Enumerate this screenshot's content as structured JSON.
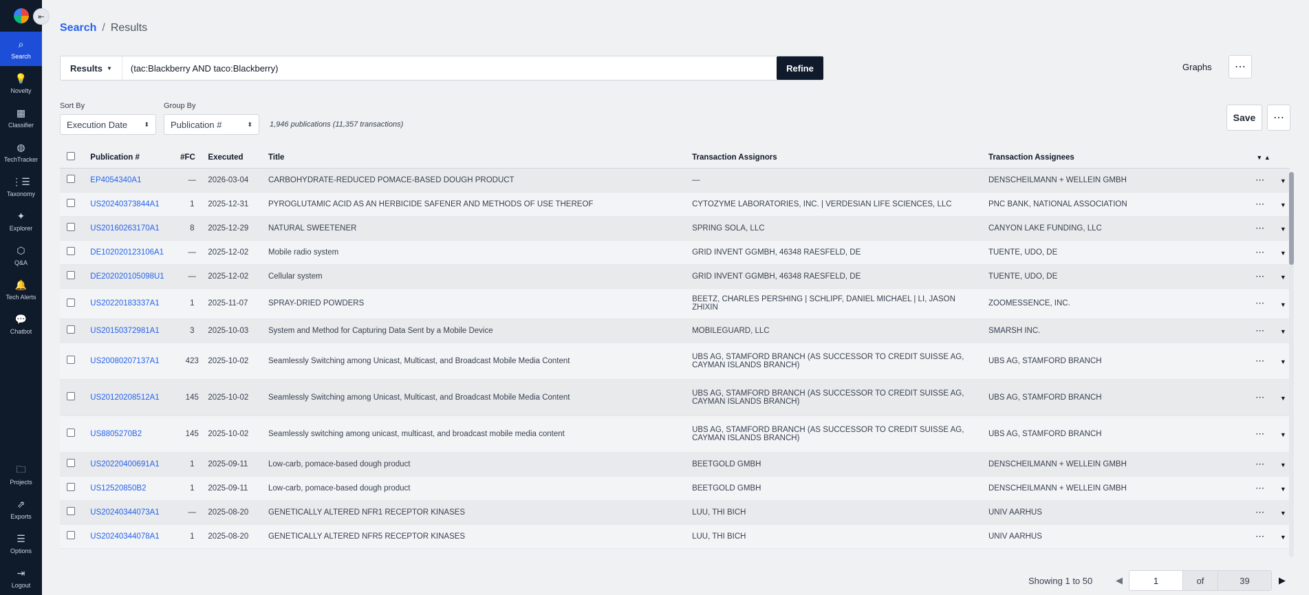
{
  "sidebar": {
    "top_items": [
      {
        "label": "Search",
        "icon": "search-icon",
        "active": true
      },
      {
        "label": "Novelty",
        "icon": "lightbulb-icon"
      },
      {
        "label": "Classifier",
        "icon": "grid-icon"
      },
      {
        "label": "TechTracker",
        "icon": "globe-icon"
      },
      {
        "label": "Taxonomy",
        "icon": "taxonomy-icon"
      },
      {
        "label": "Explorer",
        "icon": "compass-icon"
      },
      {
        "label": "Q&A",
        "icon": "cube-icon"
      },
      {
        "label": "Tech Alerts",
        "icon": "bell-icon"
      },
      {
        "label": "Chatbot",
        "icon": "chat-icon"
      }
    ],
    "bottom_items": [
      {
        "label": "Projects",
        "icon": "folder-icon"
      },
      {
        "label": "Exports",
        "icon": "export-icon"
      },
      {
        "label": "Options",
        "icon": "menu-icon"
      },
      {
        "label": "Logout",
        "icon": "logout-icon"
      }
    ]
  },
  "breadcrumb": {
    "link": "Search",
    "separator": "/",
    "current": "Results"
  },
  "query": {
    "mode": "Results",
    "text": "(tac:Blackberry AND taco:Blackberry)",
    "refine_label": "Refine"
  },
  "graphs_label": "Graphs",
  "controls": {
    "sort_label": "Sort By",
    "sort_value": "Execution Date",
    "group_label": "Group By",
    "group_value": "Publication #",
    "count_text": "1,946 publications (11,357 transactions)",
    "save_label": "Save"
  },
  "table": {
    "headers": {
      "pub": "Publication #",
      "fc": "#FC",
      "executed": "Executed",
      "title": "Title",
      "assignors": "Transaction Assignors",
      "assignees": "Transaction Assignees"
    },
    "rows": [
      {
        "pub": "EP4054340A1",
        "fc": "—",
        "executed": "2026-03-04",
        "title": "CARBOHYDRATE-REDUCED POMACE-BASED DOUGH PRODUCT",
        "assignors": "—",
        "assignees": "DENSCHEILMANN + WELLEIN GMBH"
      },
      {
        "pub": "US20240373844A1",
        "fc": "1",
        "executed": "2025-12-31",
        "title": "PYROGLUTAMIC ACID AS AN HERBICIDE SAFENER AND METHODS OF USE THEREOF",
        "assignors": "CYTOZYME LABORATORIES, INC. | VERDESIAN LIFE SCIENCES, LLC",
        "assignees": "PNC BANK, NATIONAL ASSOCIATION"
      },
      {
        "pub": "US20160263170A1",
        "fc": "8",
        "executed": "2025-12-29",
        "title": "NATURAL SWEETENER",
        "assignors": "SPRING SOLA, LLC",
        "assignees": "CANYON LAKE FUNDING, LLC"
      },
      {
        "pub": "DE102020123106A1",
        "fc": "—",
        "executed": "2025-12-02",
        "title": "Mobile radio system",
        "assignors": "GRID INVENT GGMBH, 46348 RAESFELD, DE",
        "assignees": "TUENTE, UDO, DE"
      },
      {
        "pub": "DE202020105098U1",
        "fc": "—",
        "executed": "2025-12-02",
        "title": "Cellular system",
        "assignors": "GRID INVENT GGMBH, 46348 RAESFELD, DE",
        "assignees": "TUENTE, UDO, DE"
      },
      {
        "pub": "US20220183337A1",
        "fc": "1",
        "executed": "2025-11-07",
        "title": "SPRAY-DRIED POWDERS",
        "assignors": "BEETZ, CHARLES PERSHING | SCHLIPF, DANIEL MICHAEL | LI, JASON ZHIXIN",
        "assignees": "ZOOMESSENCE, INC."
      },
      {
        "pub": "US20150372981A1",
        "fc": "3",
        "executed": "2025-10-03",
        "title": "System and Method for Capturing Data Sent by a Mobile Device",
        "assignors": "MOBILEGUARD, LLC",
        "assignees": "SMARSH INC."
      },
      {
        "pub": "US20080207137A1",
        "fc": "423",
        "executed": "2025-10-02",
        "title": "Seamlessly Switching among Unicast, Multicast, and Broadcast Mobile Media Content",
        "assignors": "UBS AG, STAMFORD BRANCH (AS SUCCESSOR TO CREDIT SUISSE AG, CAYMAN ISLANDS BRANCH)",
        "assignees": "UBS AG, STAMFORD BRANCH"
      },
      {
        "pub": "US20120208512A1",
        "fc": "145",
        "executed": "2025-10-02",
        "title": "Seamlessly Switching among Unicast, Multicast, and Broadcast Mobile Media Content",
        "assignors": "UBS AG, STAMFORD BRANCH (AS SUCCESSOR TO CREDIT SUISSE AG, CAYMAN ISLANDS BRANCH)",
        "assignees": "UBS AG, STAMFORD BRANCH"
      },
      {
        "pub": "US8805270B2",
        "fc": "145",
        "executed": "2025-10-02",
        "title": "Seamlessly switching among unicast, multicast, and broadcast mobile media content",
        "assignors": "UBS AG, STAMFORD BRANCH (AS SUCCESSOR TO CREDIT SUISSE AG, CAYMAN ISLANDS BRANCH)",
        "assignees": "UBS AG, STAMFORD BRANCH"
      },
      {
        "pub": "US20220400691A1",
        "fc": "1",
        "executed": "2025-09-11",
        "title": "Low-carb, pomace-based dough product",
        "assignors": "BEETGOLD GMBH",
        "assignees": "DENSCHEILMANN + WELLEIN GMBH"
      },
      {
        "pub": "US12520850B2",
        "fc": "1",
        "executed": "2025-09-11",
        "title": "Low-carb, pomace-based dough product",
        "assignors": "BEETGOLD GMBH",
        "assignees": "DENSCHEILMANN + WELLEIN GMBH"
      },
      {
        "pub": "US20240344073A1",
        "fc": "—",
        "executed": "2025-08-20",
        "title": "GENETICALLY ALTERED NFR1 RECEPTOR KINASES",
        "assignors": "LUU, THI BICH",
        "assignees": "UNIV AARHUS"
      },
      {
        "pub": "US20240344078A1",
        "fc": "1",
        "executed": "2025-08-20",
        "title": "GENETICALLY ALTERED NFR5 RECEPTOR KINASES",
        "assignors": "LUU, THI BICH",
        "assignees": "UNIV AARHUS"
      }
    ]
  },
  "pagination": {
    "showing": "Showing 1 to 50",
    "current": "1",
    "of": "of",
    "total": "39"
  }
}
